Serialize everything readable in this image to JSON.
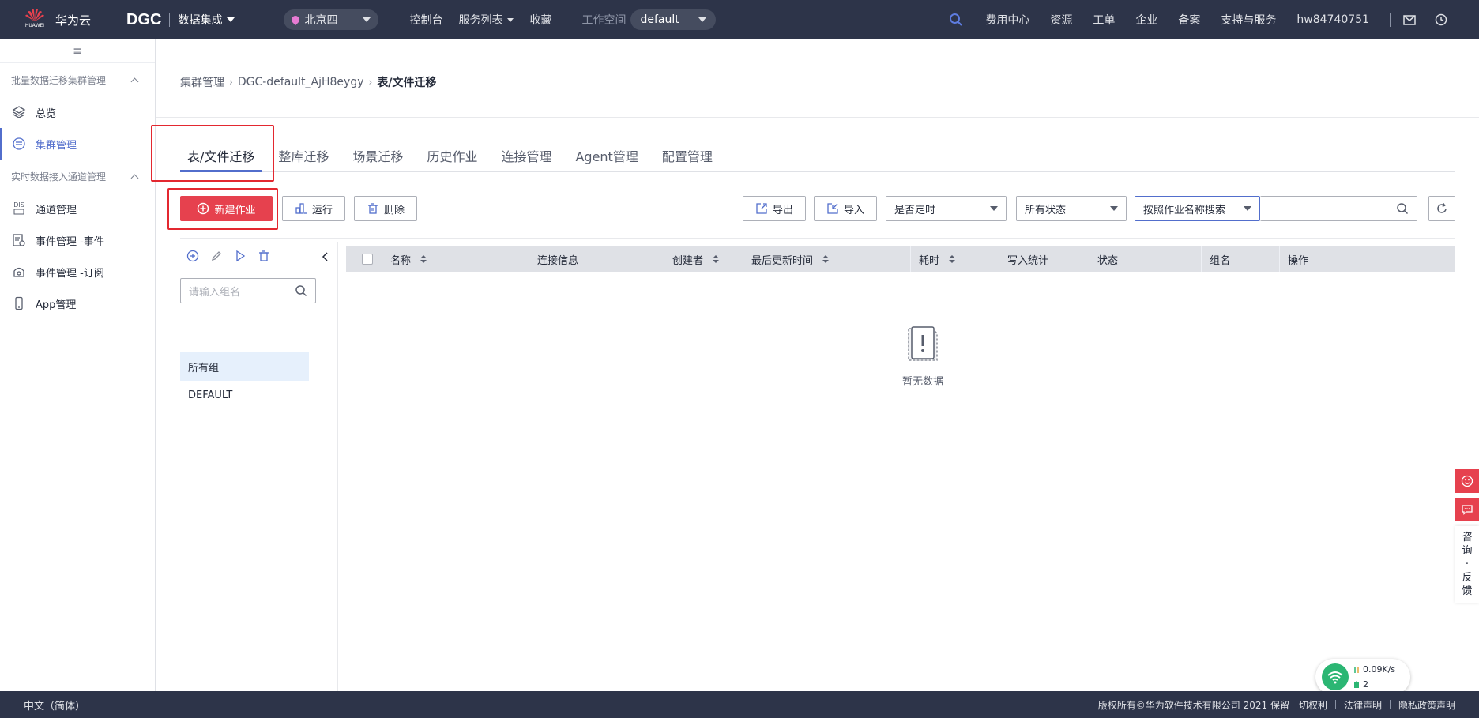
{
  "topbar": {
    "brand": "华为云",
    "logo_sub": "HUAWEI",
    "product": "DGC",
    "service": "数据集成",
    "region": "北京四",
    "nav": [
      "控制台",
      "服务列表",
      "收藏"
    ],
    "workspace_label": "工作空间",
    "workspace": "default",
    "right_nav": [
      "费用中心",
      "资源",
      "工单",
      "企业",
      "备案",
      "支持与服务",
      "hw84740751"
    ]
  },
  "sidebar": {
    "collapse_glyph": "≡",
    "section1": "批量数据迁移集群管理",
    "section1_items": [
      {
        "label": "总览",
        "icon": "layers-icon"
      },
      {
        "label": "集群管理",
        "icon": "cluster-icon"
      }
    ],
    "section2": "实时数据接入通道管理",
    "section2_items": [
      {
        "label": "通道管理",
        "icon": "dis-icon",
        "icon_text": "DIS"
      },
      {
        "label": "事件管理 -事件",
        "icon": "event-icon"
      },
      {
        "label": "事件管理 -订阅",
        "icon": "subscribe-icon"
      },
      {
        "label": "App管理",
        "icon": "app-icon"
      }
    ]
  },
  "breadcrumb": {
    "items": [
      "集群管理",
      "DGC-default_AjH8eygy"
    ],
    "current": "表/文件迁移",
    "sep": "›"
  },
  "tabs": [
    "表/文件迁移",
    "整库迁移",
    "场景迁移",
    "历史作业",
    "连接管理",
    "Agent管理",
    "配置管理"
  ],
  "toolbar": {
    "new_job": "新建作业",
    "run": "运行",
    "delete": "删除",
    "export": "导出",
    "import": "导入",
    "scheduled_select": "是否定时",
    "status_select": "所有状态",
    "search_type": "按照作业名称搜索",
    "search_value": ""
  },
  "groups": {
    "search_placeholder": "请输入组名",
    "items": [
      "所有组",
      "DEFAULT"
    ]
  },
  "table": {
    "columns": [
      "名称",
      "连接信息",
      "创建者",
      "最后更新时间",
      "耗时",
      "写入统计",
      "状态",
      "组名",
      "操作"
    ],
    "empty_text": "暂无数据"
  },
  "float": {
    "feedback_chars": [
      "咨",
      "询",
      "·",
      "反",
      "馈"
    ]
  },
  "network": {
    "speed": "0.09K/s",
    "count": "2"
  },
  "footer": {
    "lang": "中文（简体）",
    "copyright": "版权所有©华为软件技术有限公司 2021 保留一切权利",
    "legal": "法律声明",
    "privacy": "隐私政策声明"
  },
  "colors": {
    "topbar_bg": "#2d3449",
    "accent": "#526ecc",
    "primary_red": "#e6414e",
    "highlight_box": "#e32830"
  }
}
